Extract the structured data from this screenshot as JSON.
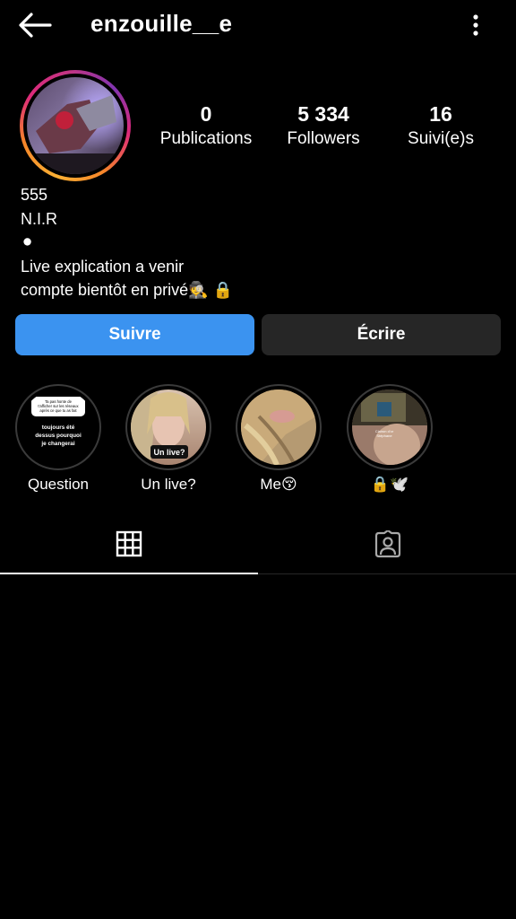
{
  "header": {
    "username": "enzouille__e",
    "back_icon": "arrow-left-icon",
    "more_icon": "more-vertical-icon"
  },
  "profile": {
    "avatar_icon": "avatar"
  },
  "stats": [
    {
      "value": "0",
      "label": "Publications"
    },
    {
      "value": "5 334",
      "label": "Followers"
    },
    {
      "value": "16",
      "label": "Suivi(e)s"
    }
  ],
  "bio": {
    "lines": [
      "555",
      "N.I.R",
      "⚫",
      "Live explication a venir",
      "compte bientôt en privé🕵 🔒"
    ]
  },
  "actions": {
    "follow_label": "Suivre",
    "message_label": "Écrire"
  },
  "highlights": [
    {
      "label": "Question",
      "cover_text": {
        "question": "Ta pas honte de t'afficher sur les réseaux après ce que tu as fait",
        "answer": "toujours été dessus pourquoi je changerai"
      }
    },
    {
      "label": "Un live?",
      "cover_text": "Un live?"
    },
    {
      "label": "Me😚"
    },
    {
      "label": "🔒🕊️"
    }
  ],
  "tabs": [
    {
      "name": "grid",
      "icon": "grid-icon",
      "active": true
    },
    {
      "name": "tagged",
      "icon": "tagged-user-icon",
      "active": false
    }
  ],
  "colors": {
    "background": "#000000",
    "follow_button": "#3b93f0",
    "message_button": "#262626",
    "story_ring_start": "#fbb034",
    "story_ring_end": "#c13584"
  }
}
